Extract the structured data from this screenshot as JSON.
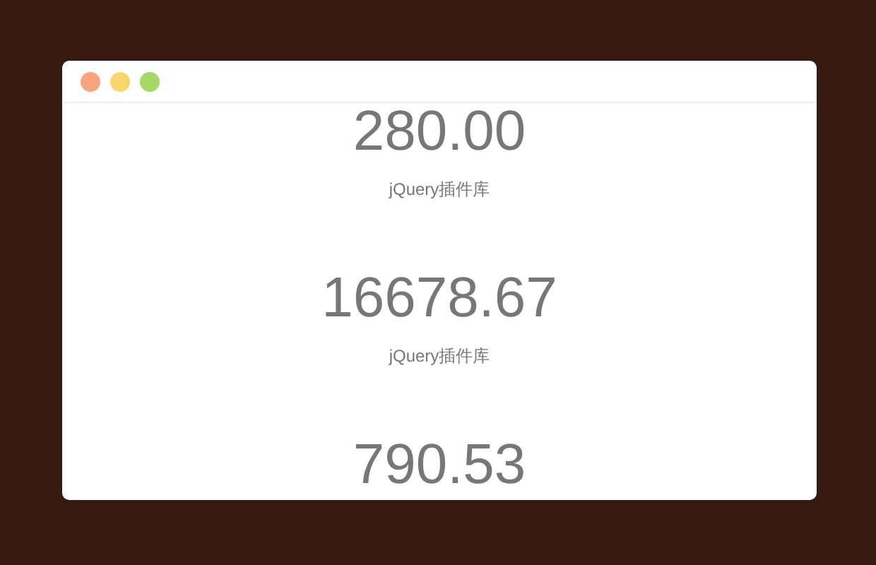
{
  "window": {
    "controls": [
      {
        "color": "#f9a47c"
      },
      {
        "color": "#f8d66e"
      },
      {
        "color": "#a5d964"
      }
    ]
  },
  "counters": [
    {
      "value": "280.00",
      "label": "jQuery插件库"
    },
    {
      "value": "16678.67",
      "label": "jQuery插件库"
    },
    {
      "value": "790.53"
    }
  ]
}
